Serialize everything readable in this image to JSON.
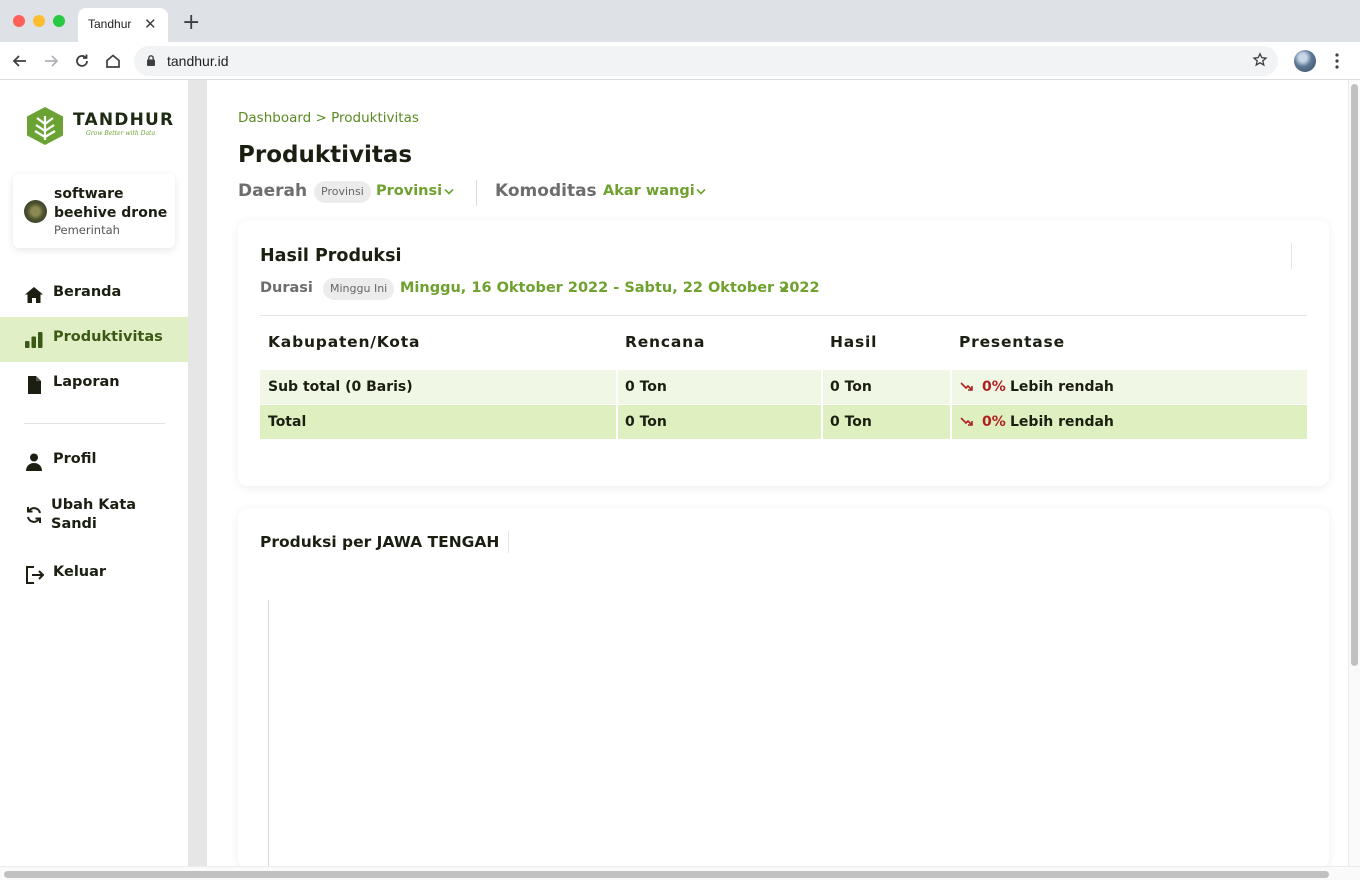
{
  "browser": {
    "tab_title": "Tandhur",
    "url": "tandhur.id"
  },
  "brand": {
    "name": "TANDHUR",
    "tagline": "Grow Better with Data",
    "accent": "#6fa12e"
  },
  "user": {
    "name": "software beehive drone",
    "role": "Pemerintah"
  },
  "sidebar": {
    "items": [
      {
        "label": "Beranda",
        "icon": "home-icon",
        "active": false
      },
      {
        "label": "Produktivitas",
        "icon": "bar-chart-icon",
        "active": true
      },
      {
        "label": "Laporan",
        "icon": "document-icon",
        "active": false
      },
      {
        "label": "Profil",
        "icon": "person-icon",
        "active": false
      },
      {
        "label": "Ubah Kata Sandi",
        "icon": "refresh-icon",
        "active": false
      },
      {
        "label": "Keluar",
        "icon": "logout-icon",
        "active": false
      }
    ]
  },
  "page": {
    "breadcrumb": "Dashboard > Produktivitas",
    "title": "Produktivitas",
    "filters": {
      "region_label": "Daerah",
      "region_pill": "Provinsi",
      "region_value": "Provinsi",
      "commodity_label": "Komoditas",
      "commodity_value": "Akar wangi"
    }
  },
  "production_card": {
    "title": "Hasil Produksi",
    "duration_label": "Durasi",
    "duration_pill": "Minggu Ini",
    "duration_value": "Minggu, 16 Oktober 2022 - Sabtu, 22 Oktober 2022",
    "columns": [
      "Kabupaten/Kota",
      "Rencana",
      "Hasil",
      "Presentase"
    ],
    "rows": [
      {
        "name": "Sub total (0 Baris)",
        "plan": "0 Ton",
        "result": "0 Ton",
        "pct": "0%",
        "pct_note": "Lebih rendah"
      },
      {
        "name": "Total",
        "plan": "0 Ton",
        "result": "0 Ton",
        "pct": "0%",
        "pct_note": "Lebih rendah"
      }
    ]
  },
  "chart_card": {
    "title": "Produksi per JAWA TENGAH"
  }
}
